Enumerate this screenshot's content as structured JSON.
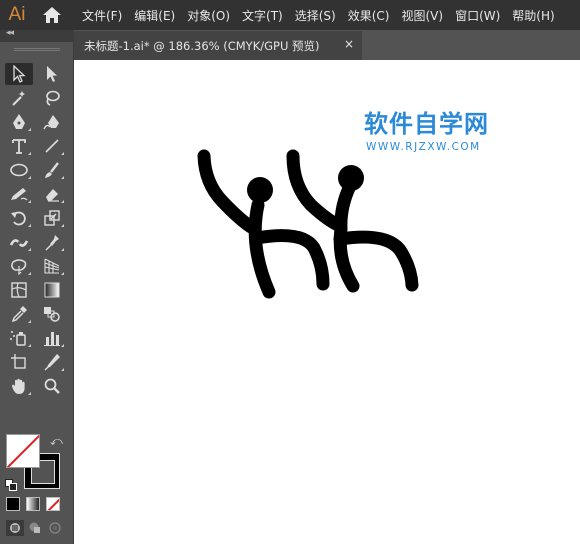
{
  "app": {
    "logo": "Ai"
  },
  "menu": {
    "items": [
      "文件(F)",
      "编辑(E)",
      "对象(O)",
      "文字(T)",
      "选择(S)",
      "效果(C)",
      "视图(V)",
      "窗口(W)",
      "帮助(H)"
    ]
  },
  "document": {
    "tab_title": "未标题-1.ai* @ 186.36% (CMYK/GPU 预览)",
    "close_glyph": "×"
  },
  "toolbar": {
    "collapse_glyph": "◂◂",
    "tools": [
      "selection-tool",
      "direct-selection-tool",
      "magic-wand-tool",
      "lasso-tool",
      "pen-tool",
      "curvature-tool",
      "type-tool",
      "line-segment-tool",
      "ellipse-tool",
      "paintbrush-tool",
      "pencil-tool",
      "eraser-tool",
      "rotate-tool",
      "scale-tool",
      "width-tool",
      "puppet-warp-tool",
      "free-transform-tool",
      "perspective-grid-tool",
      "mesh-tool",
      "gradient-tool",
      "eyedropper-tool",
      "blend-tool",
      "symbol-sprayer-tool",
      "column-graph-tool",
      "artboard-tool",
      "slice-tool",
      "hand-tool",
      "zoom-tool"
    ],
    "fill": "none",
    "stroke": "#000000",
    "swap_glyph": "⤺"
  },
  "watermark": {
    "title": "软件自学网",
    "url": "WWW.RJZXW.COM",
    "color": "#2a8ad8"
  },
  "colors": {
    "menubar_bg": "#323232",
    "panel_bg": "#535353",
    "tab_bg": "#434343",
    "canvas_bg": "#ffffff",
    "logo": "#d9883a",
    "artwork_stroke": "#000000"
  }
}
